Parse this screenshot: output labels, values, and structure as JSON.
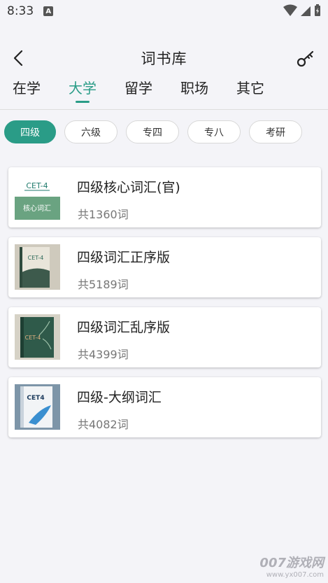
{
  "status": {
    "time": "8:33",
    "notif_icon": "A"
  },
  "header": {
    "title": "词书库",
    "back_icon": "back-arrow-icon",
    "key_icon": "key-icon"
  },
  "tabs": [
    {
      "label": "在学",
      "active": false
    },
    {
      "label": "大学",
      "active": true
    },
    {
      "label": "留学",
      "active": false
    },
    {
      "label": "职场",
      "active": false
    },
    {
      "label": "其它",
      "active": false
    }
  ],
  "chips": [
    {
      "label": "四级",
      "active": true
    },
    {
      "label": "六级",
      "active": false
    },
    {
      "label": "专四",
      "active": false
    },
    {
      "label": "专八",
      "active": false
    },
    {
      "label": "考研",
      "active": false
    }
  ],
  "books": [
    {
      "name": "四级核心词汇(官)",
      "count": "共1360词",
      "cover_top": "CET-4",
      "cover_bottom": "核心词汇"
    },
    {
      "name": "四级词汇正序版",
      "count": "共5189词",
      "cover_text": "CET-4"
    },
    {
      "name": "四级词汇乱序版",
      "count": "共4399词",
      "cover_text": "CET-4"
    },
    {
      "name": "四级-大纲词汇",
      "count": "共4082词",
      "cover_text": "CET4"
    }
  ],
  "watermark": {
    "brand": "007游戏网",
    "url": "www.yx007.com"
  },
  "colors": {
    "accent": "#2a9c87",
    "background": "#f4f4f8"
  }
}
